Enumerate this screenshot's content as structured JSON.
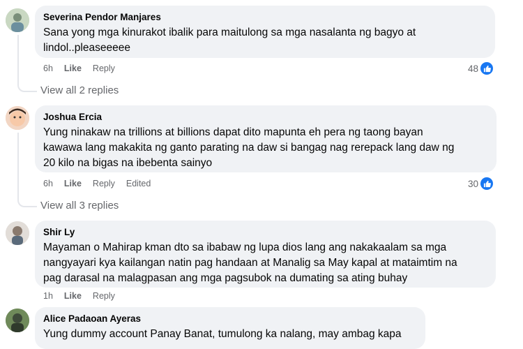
{
  "comments": [
    {
      "author": "Severina Pendor Manjares",
      "lines": [
        "Sana yong mga kinurakot ibalik para maitulong sa mga nasalanta ng bagyo at",
        "lindol..pleaseeeee"
      ],
      "time": "6h",
      "like": "Like",
      "reply": "Reply",
      "reactions": "48",
      "view_replies": "View all 2 replies"
    },
    {
      "author": "Joshua Ercia",
      "lines": [
        "Yung ninakaw na trillions at billions dapat dito mapunta eh pera ng taong bayan",
        "kawawa lang makakita ng ganto parating na daw si bangag nag rerepack lang daw ng",
        "20 kilo na bigas na ibebenta sainyo"
      ],
      "time": "6h",
      "like": "Like",
      "reply": "Reply",
      "edited": "Edited",
      "reactions": "30",
      "view_replies": "View all 3 replies"
    },
    {
      "author": "Shir Ly",
      "lines": [
        "Mayaman o Mahirap kman dto sa ibabaw ng lupa dios lang ang nakakaalam sa mga",
        "nangyayari kya kailangan natin pag handaan at Manalig sa May kapal at mataimtim na",
        "pag darasal na malagpasan ang mga pagsubok na dumating sa ating buhay"
      ],
      "time": "1h",
      "like": "Like",
      "reply": "Reply"
    },
    {
      "author": "Alice Padaoan Ayeras",
      "lines": [
        "Yung dummy account Panay Banat, tumulong ka nalang, may ambag kapa"
      ]
    }
  ],
  "colors": {
    "bubble": "#f0f2f5",
    "meta": "#65676b",
    "like_blue": "#1877f2"
  },
  "icons": {
    "reaction": "thumbs-up-icon"
  }
}
